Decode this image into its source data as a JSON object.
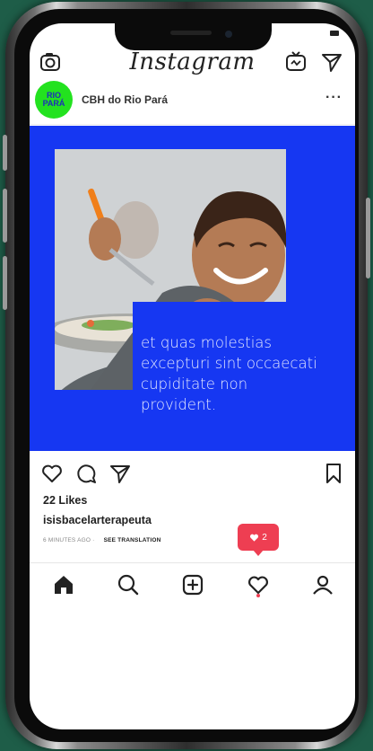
{
  "app": {
    "title": "Instagram"
  },
  "post": {
    "username": "CBH do Rio Pará",
    "avatar_text_line1": "RIO",
    "avatar_text_line2": "PARÁ",
    "caption_overlay": "et quas molestias excepturi sint occaecati cupiditate non provident.",
    "likes": "22 Likes",
    "comment_user": "isisbacelarterapeuta",
    "time_ago": "6 MINUTES AGO ·",
    "see_translation": "SEE TRANSLATION",
    "more_label": "···"
  },
  "notification": {
    "count": "2"
  },
  "colors": {
    "media_bg": "#1637f2",
    "avatar_bg": "#23e21f",
    "badge_bg": "#ee3e52",
    "page_bg": "#1e5d48"
  },
  "icons": {
    "header": [
      "camera-icon",
      "igtv-icon",
      "send-icon"
    ],
    "actions": [
      "heart-icon",
      "comment-icon",
      "share-icon",
      "bookmark-icon"
    ],
    "tabs": [
      "home-icon",
      "search-icon",
      "add-post-icon",
      "activity-icon",
      "profile-icon"
    ]
  }
}
